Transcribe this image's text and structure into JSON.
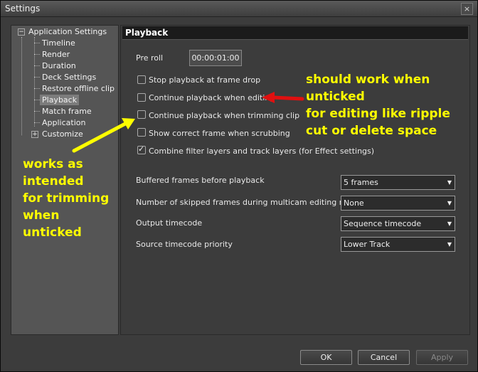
{
  "window": {
    "title": "Settings",
    "close_glyph": "×"
  },
  "tree": {
    "root": {
      "label": "Application Settings",
      "expander": "−"
    },
    "items": [
      {
        "label": "Timeline"
      },
      {
        "label": "Render"
      },
      {
        "label": "Duration"
      },
      {
        "label": "Deck Settings"
      },
      {
        "label": "Restore offline clip"
      },
      {
        "label": "Playback",
        "selected": true
      },
      {
        "label": "Match frame"
      },
      {
        "label": "Application"
      },
      {
        "label": "Customize",
        "expander": "+"
      }
    ]
  },
  "panel": {
    "title": "Playback",
    "preroll": {
      "label": "Pre roll",
      "value": "00:00:01:00"
    },
    "checkboxes": [
      {
        "label": "Stop playback at frame drop",
        "checked": false
      },
      {
        "label": "Continue playback when editing",
        "checked": false
      },
      {
        "label": "Continue playback when trimming clip",
        "checked": false
      },
      {
        "label": "Show correct frame when scrubbing",
        "checked": false
      },
      {
        "label": "Combine filter layers and track layers (for Effect settings)",
        "checked": true
      }
    ],
    "dropdowns": [
      {
        "label": "Buffered frames before playback",
        "value": "5 frames"
      },
      {
        "label": "Number of skipped frames during multicam editing mode",
        "value": "None"
      },
      {
        "label": "Output timecode",
        "value": "Sequence timecode"
      },
      {
        "label": "Source timecode priority",
        "value": "Lower Track"
      }
    ]
  },
  "buttons": {
    "ok": "OK",
    "cancel": "Cancel",
    "apply": "Apply"
  },
  "annotations": {
    "right": [
      "should work when",
      "unticked",
      "for editing like ripple",
      "cut or delete space"
    ],
    "left": [
      "works as",
      "intended",
      "for trimming",
      "when",
      "unticked"
    ],
    "right_arrow_color": "#e01010",
    "left_arrow_color": "#ffff00"
  }
}
